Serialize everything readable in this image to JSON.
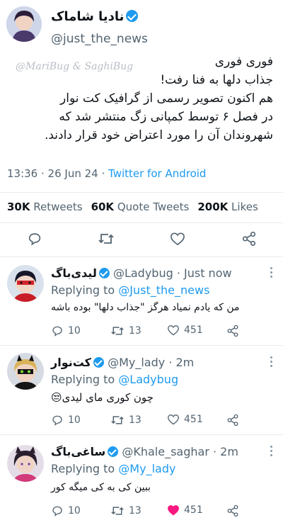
{
  "main_tweet": {
    "author_name": "نادیا شاماک",
    "handle": "@just_the_news",
    "watermark": "@MariBug & SaghiBug",
    "lines": [
      "فوری فوری",
      "جذاب دلها به فنا رفت!",
      "هم اکنون تصویر رسمی از گرافیک کت نوار",
      "در فصل ۶ توسط کمپانی زگ منتشر شد که",
      "شهروندان آن را مورد اعتراض خود قرار دادند."
    ],
    "time": "13:36",
    "date": "26 Jun 24",
    "client": "Twitter for Android",
    "stats": {
      "retweets_count": "30K",
      "retweets_label": "Retweets",
      "quotes_count": "60K",
      "quotes_label": "Quote Tweets",
      "likes_count": "200K",
      "likes_label": "Likes"
    }
  },
  "replies": [
    {
      "name": "لیدی‌باگ",
      "handle": "@Ladybug",
      "time": "Just now",
      "replying_label": "Replying to",
      "replying_to": "@Just_the_news",
      "text": "من که یادم نمیاد هرگز \"جذاب دلها\" بوده باشه",
      "emoji": "",
      "replies": "10",
      "retweets": "13",
      "likes": "451",
      "liked": false
    },
    {
      "name": "کت‌نوار",
      "handle": "@My_lady",
      "time": "2m",
      "replying_label": "Replying to",
      "replying_to": "@Ladybug",
      "text": "چون کوری مای لیدی",
      "emoji": "😒",
      "replies": "10",
      "retweets": "13",
      "likes": "451",
      "liked": false
    },
    {
      "name": "ساغی‌باگ",
      "handle": "@Khale_saghar",
      "time": "2m",
      "replying_label": "Replying to",
      "replying_to": "@My_lady",
      "text": "ببین کی به کی میگه کور",
      "emoji": "",
      "replies": "10",
      "retweets": "13",
      "likes": "451",
      "liked": true
    }
  ],
  "colors": {
    "accent": "#1d9bf0",
    "text": "#0f1419",
    "muted": "#536471",
    "like": "#f91880",
    "divider": "#e6ecf0"
  }
}
